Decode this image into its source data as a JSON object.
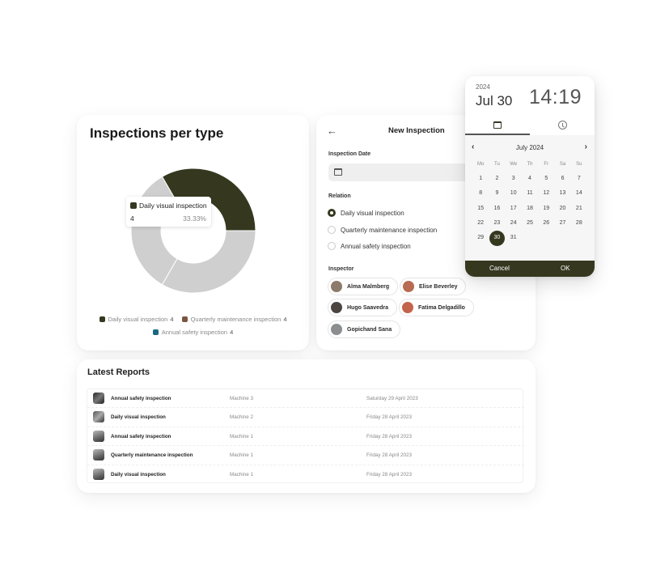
{
  "colors": {
    "brand": "#35381f",
    "daily": "#35381f",
    "quarterly": "#7a5540",
    "annual": "#196a80",
    "inactive_slice": "#cfcfcf"
  },
  "chart_card": {
    "title": "Inspections per type",
    "tooltip": {
      "label": "Daily visual inspection",
      "value": "4",
      "percent": "33.33%"
    }
  },
  "chart_data": {
    "type": "pie",
    "title": "Inspections per type",
    "donut": true,
    "highlighted": "Daily visual inspection",
    "categories": [
      "Daily visual inspection",
      "Quarterly maintenance inspection",
      "Annual safety inspection"
    ],
    "values": [
      4,
      4,
      4
    ],
    "legend": [
      {
        "label": "Daily visual inspection",
        "count": "4",
        "color": "#35381f"
      },
      {
        "label": "Quarterly maintenance inspection",
        "count": "4",
        "color": "#7a5540"
      },
      {
        "label": "Annual safety inspection",
        "count": "4",
        "color": "#196a80"
      }
    ],
    "legend_position": "bottom"
  },
  "form": {
    "back_icon": "arrow-left-icon",
    "title": "New Inspection",
    "date_label": "Inspection Date",
    "date_value": "",
    "relation_label": "Relation",
    "relations": [
      {
        "label": "Daily visual inspection",
        "selected": true
      },
      {
        "label": "Quarterly maintenance inspection",
        "selected": false
      },
      {
        "label": "Annual safety inspection",
        "selected": false
      }
    ],
    "inspector_label": "Inspector",
    "inspectors": [
      {
        "name": "Alma Malmberg",
        "avatar_color": "#8c7a6a"
      },
      {
        "name": "Elise Beverley",
        "avatar_color": "#b86a52"
      },
      {
        "name": "Hugo Saavedra",
        "avatar_color": "#4a4540"
      },
      {
        "name": "Fatima Delgadillo",
        "avatar_color": "#c4634c"
      },
      {
        "name": "Gopichand Sana",
        "avatar_color": "#8a8e90"
      }
    ]
  },
  "picker": {
    "year": "2024",
    "date": "Jul 30",
    "time": "14:19",
    "tabs": [
      "calendar-icon",
      "clock-icon"
    ],
    "month": "July 2024",
    "prev": "‹",
    "next": "›",
    "weekdays": [
      "Mo",
      "Tu",
      "We",
      "Th",
      "Fr",
      "Sa",
      "Su"
    ],
    "weeks": [
      [
        "1",
        "2",
        "3",
        "4",
        "5",
        "6",
        "7"
      ],
      [
        "8",
        "9",
        "10",
        "11",
        "12",
        "13",
        "14"
      ],
      [
        "15",
        "16",
        "17",
        "18",
        "19",
        "20",
        "21"
      ],
      [
        "22",
        "23",
        "24",
        "25",
        "26",
        "27",
        "28"
      ],
      [
        "29",
        "30",
        "31",
        "",
        "",
        "",
        ""
      ]
    ],
    "selected_day": "30",
    "cancel": "Cancel",
    "ok": "OK"
  },
  "reports": {
    "title": "Latest Reports",
    "rows": [
      {
        "name": "Annual safety inspection",
        "machine": "Machine 3",
        "date": "Saturday 29 April 2023"
      },
      {
        "name": "Daily visual inspection",
        "machine": "Machine 2",
        "date": "Friday 28 April 2023"
      },
      {
        "name": "Annual safety inspection",
        "machine": "Machine 1",
        "date": "Friday 28 April 2023"
      },
      {
        "name": "Quarterly maintenance inspection",
        "machine": "Machine 1",
        "date": "Friday 28 April 2023"
      },
      {
        "name": "Daily visual inspection",
        "machine": "Machine 1",
        "date": "Friday 28 April 2023"
      }
    ]
  }
}
